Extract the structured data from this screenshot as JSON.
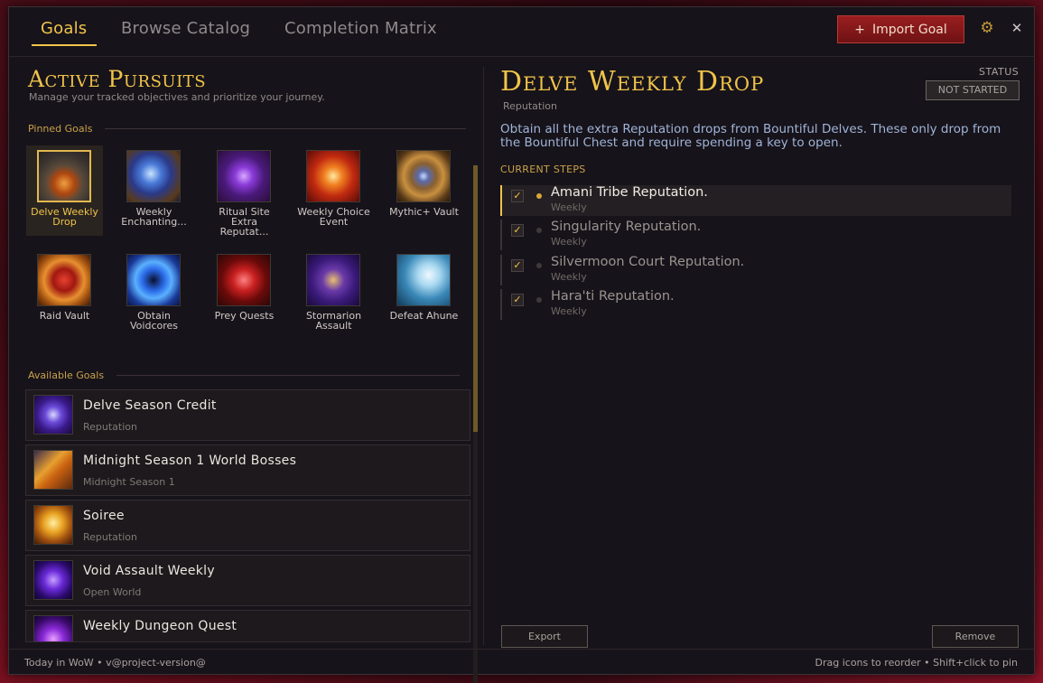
{
  "tabs": [
    {
      "label": "Goals"
    },
    {
      "label": "Browse Catalog"
    },
    {
      "label": "Completion Matrix"
    }
  ],
  "toolbar": {
    "import_label": "Import Goal",
    "import_icon": "+"
  },
  "left": {
    "title": "Active Pursuits",
    "subtitle": "Manage your tracked objectives and prioritize your journey.",
    "pinned_label": "Pinned Goals",
    "available_label": "Available Goals",
    "pinned": [
      {
        "label": "Delve Weekly Drop",
        "icon": "cave-portal-icon"
      },
      {
        "label": "Weekly Enchanting...",
        "icon": "enchanting-crystal-icon"
      },
      {
        "label": "Ritual Site Extra Reputat...",
        "icon": "ritual-figure-icon"
      },
      {
        "label": "Weekly Choice Event",
        "icon": "fire-burst-icon"
      },
      {
        "label": "Mythic+ Vault",
        "icon": "vault-compass-icon"
      },
      {
        "label": "Raid Vault",
        "icon": "raid-vault-icon"
      },
      {
        "label": "Obtain Voidcores",
        "icon": "void-swirl-icon"
      },
      {
        "label": "Prey Quests",
        "icon": "red-crystal-icon"
      },
      {
        "label": "Stormarion Assault",
        "icon": "serpent-ring-icon"
      },
      {
        "label": "Defeat Ahune",
        "icon": "ice-elemental-icon"
      }
    ],
    "available": [
      {
        "name": "Delve Season Credit",
        "category": "Reputation",
        "icon": "void-sigil-icon"
      },
      {
        "name": "Midnight Season 1 World Bosses",
        "category": "Midnight Season 1",
        "icon": "golden-weapon-icon"
      },
      {
        "name": "Soiree",
        "category": "Reputation",
        "icon": "golden-crest-icon"
      },
      {
        "name": "Void Assault Weekly",
        "category": "Open World",
        "icon": "void-rune-icon"
      },
      {
        "name": "Weekly Dungeon Quest",
        "category": "",
        "icon": "dungeon-swirl-icon"
      }
    ]
  },
  "detail": {
    "title": "Delve Weekly Drop",
    "category": "Reputation",
    "status_label": "STATUS",
    "status": "NOT STARTED",
    "description": "Obtain all the extra Reputation drops from Bountiful Delves. These only drop from the Bountiful Chest and require spending a key to open.",
    "steps_header": "CURRENT STEPS",
    "steps": [
      {
        "text": "Amani Tribe Reputation.",
        "freq": "Weekly",
        "checked": true
      },
      {
        "text": "Singularity Reputation.",
        "freq": "Weekly",
        "checked": true
      },
      {
        "text": "Silvermoon Court Reputation.",
        "freq": "Weekly",
        "checked": true
      },
      {
        "text": "Hara'ti Reputation.",
        "freq": "Weekly",
        "checked": true
      }
    ],
    "export_label": "Export",
    "remove_label": "Remove"
  },
  "footer": {
    "left": "Today in WoW  •  v@project-version@",
    "right": "Drag icons to reorder  •  Shift+click to pin"
  },
  "colors": {
    "accent_gold": "#f0c44a",
    "import_red": "#9a1e20",
    "desc_blue": "#9fb4d8"
  }
}
